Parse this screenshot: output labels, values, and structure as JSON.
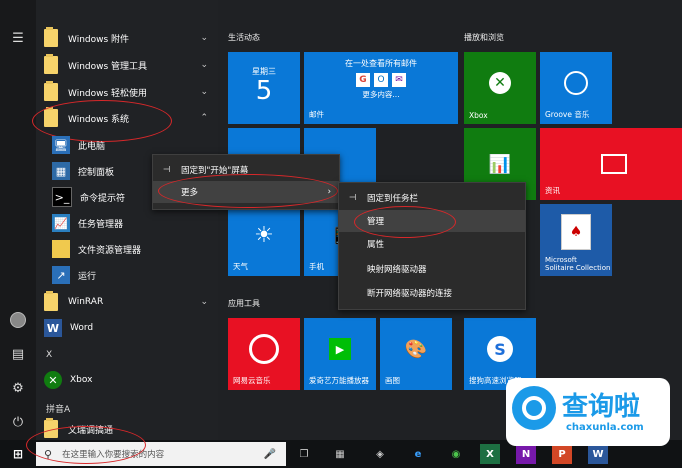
{
  "applist": {
    "items": [
      {
        "label": "Windows 附件",
        "chev": "⌄"
      },
      {
        "label": "Windows 管理工具",
        "chev": "⌄"
      },
      {
        "label": "Windows 轻松使用",
        "chev": "⌄"
      },
      {
        "label": "Windows 系统",
        "chev": "⌃"
      },
      {
        "label": "此电脑"
      },
      {
        "label": "控制面板"
      },
      {
        "label": "命令提示符"
      },
      {
        "label": "任务管理器"
      },
      {
        "label": "文件资源管理器"
      },
      {
        "label": "运行"
      },
      {
        "label": "WinRAR",
        "chev": "⌄"
      },
      {
        "label": "Word"
      }
    ],
    "letter_x": "X",
    "xbox_label": "Xbox",
    "letter_pinyin": "拼音A",
    "last_label": "文瑞调搞通"
  },
  "tiles": {
    "group1_title": "生活动态",
    "group2_title": "播放和浏览",
    "group3_title": "应用工具",
    "calendar": {
      "weekday": "星期三",
      "day": "5"
    },
    "mail": {
      "header": "在一处查看所有邮件",
      "more": "更多内容...",
      "label": "邮件"
    },
    "xbox": "Xbox",
    "groove": "Groove 音乐",
    "news": "资讯",
    "weather": "天气",
    "phone": "手机",
    "solitaire": "Microsoft\nSolitaire Collection",
    "netease": "网易云音乐",
    "iqiyi": "爱奇艺万能播放器",
    "paint": "画图",
    "sogou": "搜狗高速浏览器"
  },
  "menu1": {
    "pin_start": "固定到\"开始\"屏幕",
    "more": "更多"
  },
  "menu2": {
    "pin_taskbar": "固定到任务栏",
    "manage": "管理",
    "properties": "属性",
    "map_drive": "映射网络驱动器",
    "disconnect_drive": "断开网络驱动器的连接"
  },
  "taskbar": {
    "search_placeholder": "在这里输入你要搜索的内容"
  },
  "watermark": {
    "brand": "查询啦",
    "url": "chaxunla.com"
  },
  "colors": {
    "tile_blue": "#0a78d7",
    "xbox_green": "#107c10",
    "news_red": "#e81123",
    "highlight_ellipse": "#d6282a"
  }
}
